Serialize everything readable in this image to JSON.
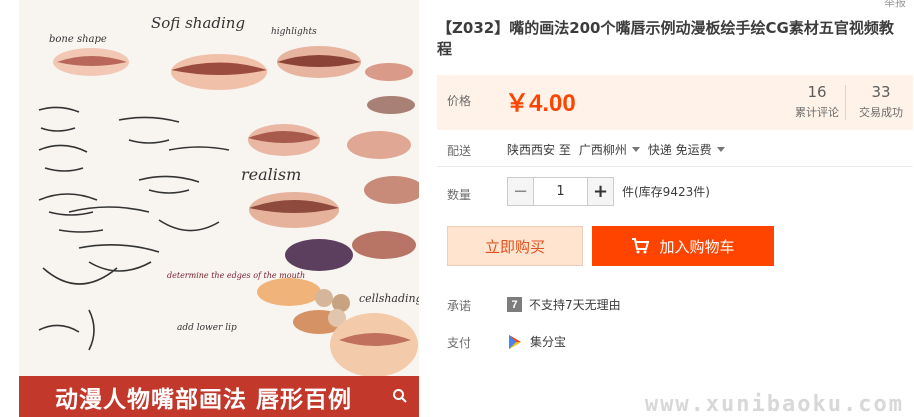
{
  "gallery": {
    "banner_text": "动漫人物嘴部画法 唇形百例",
    "art_labels": [
      "bone shape",
      "Sofi shading",
      "highlights",
      "realism",
      "determine the edges of the mouth",
      "add lower lip",
      "cellshading"
    ]
  },
  "top": {
    "report_link": "举报"
  },
  "product": {
    "title": "【Z032】嘴的画法200个嘴唇示例动漫板绘手绘CG素材五官视频教程"
  },
  "price": {
    "label": "价格",
    "value": "￥4.00",
    "stats": [
      {
        "num": "16",
        "label": "累计评论"
      },
      {
        "num": "33",
        "label": "交易成功"
      }
    ]
  },
  "shipping": {
    "label": "配送",
    "from": "陕西西安 至",
    "to": "广西柳州",
    "method": "快递 免运费"
  },
  "quantity": {
    "label": "数量",
    "minus": "−",
    "value": "1",
    "plus": "+",
    "stock": "件(库存9423件)"
  },
  "actions": {
    "buy_now": "立即购买",
    "add_to_cart": "加入购物车"
  },
  "promise": {
    "label": "承诺",
    "badge": "7",
    "text": "不支持7天无理由"
  },
  "payment": {
    "label": "支付",
    "text": "集分宝"
  },
  "watermark": "www.xunibaoku.com",
  "colors": {
    "accent": "#ff4400",
    "price_bg": "#fff2e8",
    "banner": "#c2382b"
  },
  "icons": [
    "search-icon",
    "cart-icon",
    "seven-day-icon",
    "jifenbao-icon",
    "dropdown-icon"
  ]
}
